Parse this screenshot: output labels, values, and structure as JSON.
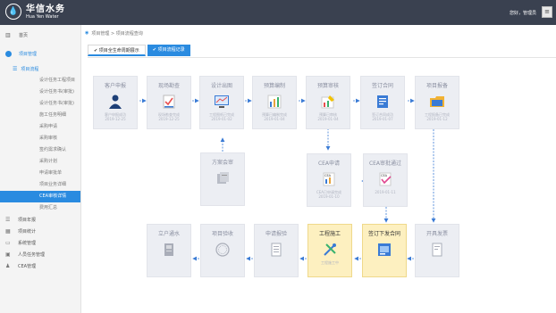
{
  "header": {
    "logo_cn": "华信水务",
    "logo_en": "Hua Yen Water",
    "user_text": "您好，管理员"
  },
  "sidebar": {
    "top_item": "首页",
    "section": "项目管理",
    "sub_section": "项目流程",
    "items": [
      "设计任务工程项目",
      "设计任务书(审批)",
      "设计任务书(审批)",
      "施工任务明细",
      "采购申请",
      "采购审核",
      "签约需求确认",
      "采购计划",
      "申请审批单",
      "项目业务详细",
      "CEA审核详情",
      "费用汇总"
    ],
    "active_index": 10,
    "menus": [
      "项目年报",
      "项目统计",
      "系统管理",
      "人员任务管理",
      "CEA管理"
    ]
  },
  "breadcrumb": "项目管理 > 项目流程查询",
  "tabs": [
    {
      "label": "项目全生命周期展示"
    },
    {
      "label": "项目流程记录"
    }
  ],
  "flow": {
    "row1": [
      {
        "title": "客户申报",
        "note1": "客户申报成功",
        "note2": "2019-12-25",
        "icon": "user-icon"
      },
      {
        "title": "现场勘查",
        "note1": "现场勘查完成",
        "note2": "2019-12-25",
        "icon": "check-doc-icon"
      },
      {
        "title": "设计出图",
        "note1": "工程图纸已完成",
        "note2": "2019-01-02",
        "icon": "monitor-chart-icon"
      },
      {
        "title": "预算编制",
        "note1": "预算已编制完成",
        "note2": "2019-01-04",
        "icon": "bar-chart-icon"
      },
      {
        "title": "预算审核",
        "note1": "预算已审核",
        "note2": "2019-01-04",
        "icon": "edit-chart-icon"
      },
      {
        "title": "签订合同",
        "note1": "签订合同成功",
        "note2": "2019-01-07",
        "icon": "contract-icon"
      },
      {
        "title": "项目报备",
        "note1": "工程报备已完成",
        "note2": "2019-01-12",
        "icon": "folder-icon"
      }
    ],
    "plan_review": {
      "title": "方案会审",
      "icon": "review-icon"
    },
    "cea": [
      {
        "title": "CEA申请",
        "note1": "CEA已申请完成",
        "note2": "2019-01-10",
        "icon": "cea-apply-icon"
      },
      {
        "title": "CEA审批通过",
        "note1": "",
        "note2": "2019-01-11",
        "icon": "cea-approve-icon"
      }
    ],
    "row3": [
      {
        "title": "立户通水",
        "note1": "",
        "icon": "meter-icon",
        "hl": false
      },
      {
        "title": "项目验收",
        "note1": "",
        "icon": "stamp-icon",
        "hl": false
      },
      {
        "title": "申请报验",
        "note1": "",
        "icon": "document-icon",
        "hl": false
      },
      {
        "title": "工程施工",
        "note1": "工程施工中",
        "icon": "tools-icon",
        "hl": true
      },
      {
        "title": "签订下发合同",
        "note1": "",
        "icon": "sign-contract-icon",
        "hl": true
      },
      {
        "title": "开具发票",
        "note1": "",
        "icon": "invoice-icon",
        "hl": false
      }
    ]
  },
  "colors": {
    "topbar": "#3a4150",
    "accent": "#2a8be0",
    "highlight": "#fdf0c0"
  }
}
